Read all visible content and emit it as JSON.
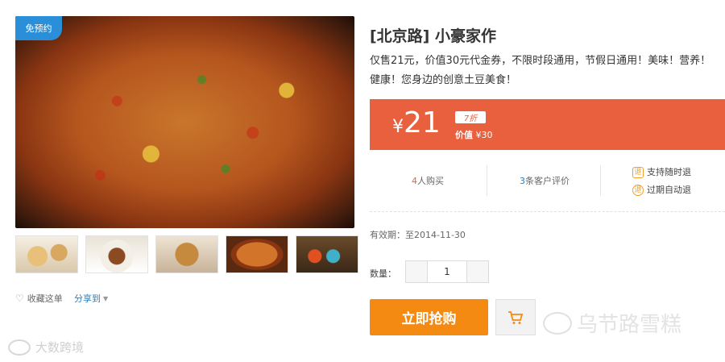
{
  "gallery": {
    "badge": "免预约",
    "thumbnails": [
      {
        "icon": "pastry-thumbnail"
      },
      {
        "icon": "rice-dish-thumbnail"
      },
      {
        "icon": "dessert-thumbnail"
      },
      {
        "icon": "pizza-thumbnail"
      },
      {
        "icon": "drinks-thumbnail"
      }
    ],
    "favorite_label": "收藏这单",
    "share_label": "分享到"
  },
  "deal": {
    "title": "[北京路] 小豪家作",
    "description": "仅售21元，价值30元代金券，不限时段通用，节假日通用！美味！营养！健康！您身边的创意土豆美食！",
    "price_currency": "¥",
    "price_value": "21",
    "discount": "7折",
    "value_label": "价值",
    "value_amount": "¥30"
  },
  "stats": {
    "bought_count": "4",
    "bought_label": "人购买",
    "review_count": "3",
    "review_label": "条客户评价",
    "refund_anytime": "支持随时退",
    "refund_expired": "过期自动退"
  },
  "validity": "有效期：至2014-11-30",
  "purchase": {
    "qty_label": "数量：",
    "qty_value": "1",
    "buy_label": "立即抢购"
  },
  "watermarks": {
    "left": "大数跨境",
    "right": "乌节路雪糕"
  },
  "colors": {
    "price_bar": "#e9603f",
    "buy_button": "#f58a12",
    "badge": "#2a8fd8",
    "link": "#2a7fc0"
  }
}
